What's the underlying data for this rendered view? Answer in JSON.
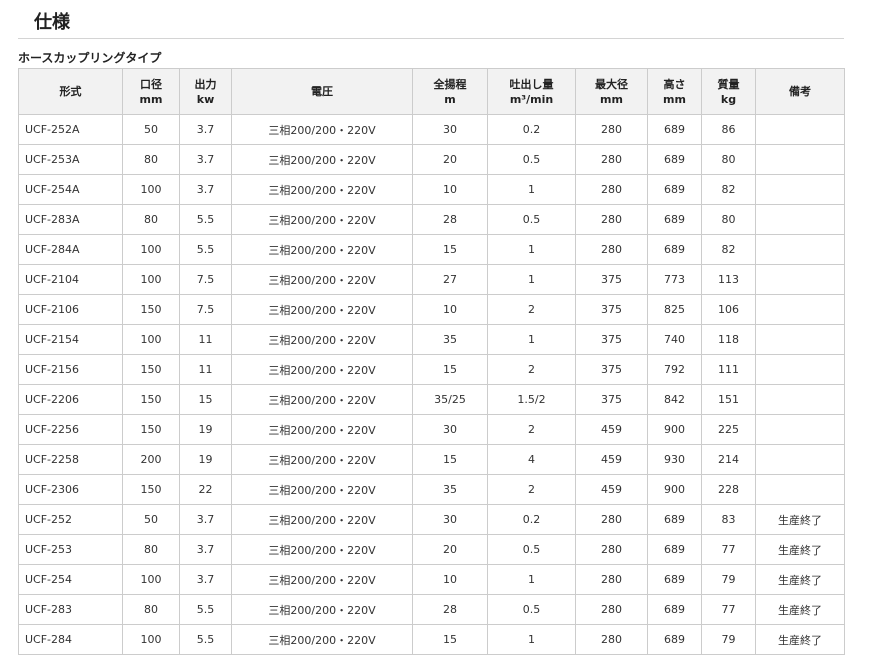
{
  "page": {
    "title": "仕様",
    "section_title": "ホースカップリングタイプ"
  },
  "table": {
    "headers": [
      {
        "line1": "形式",
        "line2": ""
      },
      {
        "line1": "口径",
        "line2": "mm"
      },
      {
        "line1": "出力",
        "line2": "kw"
      },
      {
        "line1": "電圧",
        "line2": ""
      },
      {
        "line1": "全揚程",
        "line2": "m"
      },
      {
        "line1": "吐出し量",
        "line2": "m³/min"
      },
      {
        "line1": "最大径",
        "line2": "mm"
      },
      {
        "line1": "高さ",
        "line2": "mm"
      },
      {
        "line1": "質量",
        "line2": "kg"
      },
      {
        "line1": "備考",
        "line2": ""
      }
    ],
    "rows": [
      [
        "UCF-252A",
        "50",
        "3.7",
        "三相200/200・220V",
        "30",
        "0.2",
        "280",
        "689",
        "86",
        ""
      ],
      [
        "UCF-253A",
        "80",
        "3.7",
        "三相200/200・220V",
        "20",
        "0.5",
        "280",
        "689",
        "80",
        ""
      ],
      [
        "UCF-254A",
        "100",
        "3.7",
        "三相200/200・220V",
        "10",
        "1",
        "280",
        "689",
        "82",
        ""
      ],
      [
        "UCF-283A",
        "80",
        "5.5",
        "三相200/200・220V",
        "28",
        "0.5",
        "280",
        "689",
        "80",
        ""
      ],
      [
        "UCF-284A",
        "100",
        "5.5",
        "三相200/200・220V",
        "15",
        "1",
        "280",
        "689",
        "82",
        ""
      ],
      [
        "UCF-2104",
        "100",
        "7.5",
        "三相200/200・220V",
        "27",
        "1",
        "375",
        "773",
        "113",
        ""
      ],
      [
        "UCF-2106",
        "150",
        "7.5",
        "三相200/200・220V",
        "10",
        "2",
        "375",
        "825",
        "106",
        ""
      ],
      [
        "UCF-2154",
        "100",
        "11",
        "三相200/200・220V",
        "35",
        "1",
        "375",
        "740",
        "118",
        ""
      ],
      [
        "UCF-2156",
        "150",
        "11",
        "三相200/200・220V",
        "15",
        "2",
        "375",
        "792",
        "111",
        ""
      ],
      [
        "UCF-2206",
        "150",
        "15",
        "三相200/200・220V",
        "35/25",
        "1.5/2",
        "375",
        "842",
        "151",
        ""
      ],
      [
        "UCF-2256",
        "150",
        "19",
        "三相200/200・220V",
        "30",
        "2",
        "459",
        "900",
        "225",
        ""
      ],
      [
        "UCF-2258",
        "200",
        "19",
        "三相200/200・220V",
        "15",
        "4",
        "459",
        "930",
        "214",
        ""
      ],
      [
        "UCF-2306",
        "150",
        "22",
        "三相200/200・220V",
        "35",
        "2",
        "459",
        "900",
        "228",
        ""
      ],
      [
        "UCF-252",
        "50",
        "3.7",
        "三相200/200・220V",
        "30",
        "0.2",
        "280",
        "689",
        "83",
        "生産終了"
      ],
      [
        "UCF-253",
        "80",
        "3.7",
        "三相200/200・220V",
        "20",
        "0.5",
        "280",
        "689",
        "77",
        "生産終了"
      ],
      [
        "UCF-254",
        "100",
        "3.7",
        "三相200/200・220V",
        "10",
        "1",
        "280",
        "689",
        "79",
        "生産終了"
      ],
      [
        "UCF-283",
        "80",
        "5.5",
        "三相200/200・220V",
        "28",
        "0.5",
        "280",
        "689",
        "77",
        "生産終了"
      ],
      [
        "UCF-284",
        "100",
        "5.5",
        "三相200/200・220V",
        "15",
        "1",
        "280",
        "689",
        "79",
        "生産終了"
      ]
    ]
  }
}
